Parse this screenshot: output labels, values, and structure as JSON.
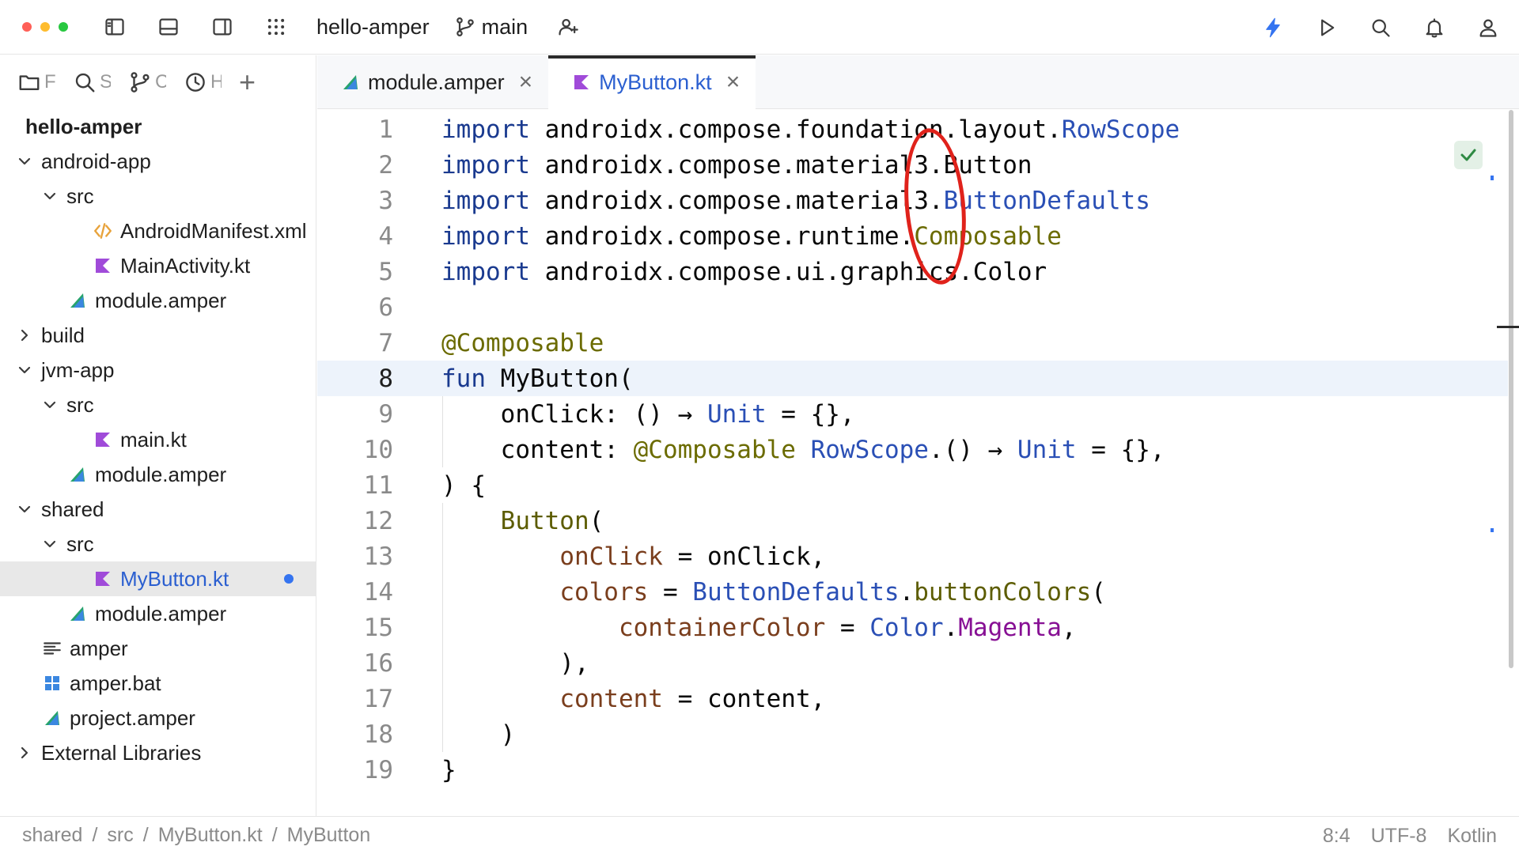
{
  "titlebar": {
    "project_name": "hello-amper",
    "branch": "main",
    "traffic_colors": {
      "close": "#ff5f57",
      "minimize": "#febc2e",
      "zoom": "#28c840"
    }
  },
  "left_tabs": [
    {
      "icon": "folder-icon",
      "label": "F"
    },
    {
      "icon": "search-icon",
      "label": "S"
    },
    {
      "icon": "git-branch-icon",
      "label": "C"
    },
    {
      "icon": "clock-icon",
      "label": "H"
    }
  ],
  "tree": {
    "root": "hello-amper",
    "items": [
      {
        "label": "android-app",
        "depth": 0,
        "chevron": "down",
        "icon": ""
      },
      {
        "label": "src",
        "depth": 1,
        "chevron": "down",
        "icon": ""
      },
      {
        "label": "AndroidManifest.xml",
        "depth": 2,
        "chevron": "",
        "icon": "xml-icon"
      },
      {
        "label": "MainActivity.kt",
        "depth": 2,
        "chevron": "",
        "icon": "kotlin-icon"
      },
      {
        "label": "module.amper",
        "depth": 1,
        "chevron": "",
        "icon": "amper-icon"
      },
      {
        "label": "build",
        "depth": 0,
        "chevron": "right",
        "icon": ""
      },
      {
        "label": "jvm-app",
        "depth": 0,
        "chevron": "down",
        "icon": ""
      },
      {
        "label": "src",
        "depth": 1,
        "chevron": "down",
        "icon": ""
      },
      {
        "label": "main.kt",
        "depth": 2,
        "chevron": "",
        "icon": "kotlin-icon"
      },
      {
        "label": "module.amper",
        "depth": 1,
        "chevron": "",
        "icon": "amper-icon"
      },
      {
        "label": "shared",
        "depth": 0,
        "chevron": "down",
        "icon": ""
      },
      {
        "label": "src",
        "depth": 1,
        "chevron": "down",
        "icon": ""
      },
      {
        "label": "MyButton.kt",
        "depth": 2,
        "chevron": "",
        "icon": "kotlin-icon",
        "selected": true,
        "modified": true
      },
      {
        "label": "module.amper",
        "depth": 1,
        "chevron": "",
        "icon": "amper-icon"
      },
      {
        "label": "amper",
        "depth": 0,
        "chevron": "",
        "icon": "text-file-icon"
      },
      {
        "label": "amper.bat",
        "depth": 0,
        "chevron": "",
        "icon": "windows-icon"
      },
      {
        "label": "project.amper",
        "depth": 0,
        "chevron": "",
        "icon": "amper-icon"
      },
      {
        "label": "External Libraries",
        "depth": 0,
        "chevron": "right",
        "icon": ""
      }
    ]
  },
  "editor_tabs": [
    {
      "label": "module.amper",
      "icon": "amper-icon",
      "active": false
    },
    {
      "label": "MyButton.kt",
      "icon": "kotlin-icon",
      "active": true
    }
  ],
  "editor": {
    "current_line": 8,
    "lines": [
      [
        [
          "import",
          "kw"
        ],
        [
          " androidx.compose.foundation.layout.",
          "pkg"
        ],
        [
          "RowScope",
          "cls"
        ]
      ],
      [
        [
          "import",
          "kw"
        ],
        [
          " androidx.compose.material3.Button",
          "pkg"
        ]
      ],
      [
        [
          "import",
          "kw"
        ],
        [
          " androidx.compose.material3.",
          "pkg"
        ],
        [
          "ButtonDefaults",
          "cls"
        ]
      ],
      [
        [
          "import",
          "kw"
        ],
        [
          " androidx.compose.runtime.",
          "pkg"
        ],
        [
          "Composable",
          "ann"
        ]
      ],
      [
        [
          "import",
          "kw"
        ],
        [
          " androidx.compose.ui.graphics.Color",
          "pkg"
        ]
      ],
      [],
      [
        [
          "@Composable",
          "ann"
        ]
      ],
      [
        [
          "fun",
          "kw"
        ],
        [
          " MyButton(",
          "fn"
        ]
      ],
      [
        [
          "    onClick: () → ",
          "plain"
        ],
        [
          "Unit",
          "cls"
        ],
        [
          " = {},",
          "plain"
        ]
      ],
      [
        [
          "    content: ",
          "plain"
        ],
        [
          "@Composable",
          "ann"
        ],
        [
          " ",
          "plain"
        ],
        [
          "RowScope",
          "cls"
        ],
        [
          ".() → ",
          "plain"
        ],
        [
          "Unit",
          "cls"
        ],
        [
          " = {},",
          "plain"
        ]
      ],
      [
        [
          ") {",
          "plain"
        ]
      ],
      [
        [
          "    ",
          "plain"
        ],
        [
          "Button",
          "call"
        ],
        [
          "(",
          "plain"
        ]
      ],
      [
        [
          "        ",
          "plain"
        ],
        [
          "onClick",
          "param"
        ],
        [
          " = onClick,",
          "plain"
        ]
      ],
      [
        [
          "        ",
          "plain"
        ],
        [
          "colors",
          "param"
        ],
        [
          " = ",
          "plain"
        ],
        [
          "ButtonDefaults",
          "cls"
        ],
        [
          ".",
          "plain"
        ],
        [
          "buttonColors",
          "call"
        ],
        [
          "(",
          "plain"
        ]
      ],
      [
        [
          "            ",
          "plain"
        ],
        [
          "containerColor",
          "param"
        ],
        [
          " = ",
          "plain"
        ],
        [
          "Color",
          "cls"
        ],
        [
          ".",
          "plain"
        ],
        [
          "Magenta",
          "prop"
        ],
        [
          ",",
          "plain"
        ]
      ],
      [
        [
          "        ),",
          "plain"
        ]
      ],
      [
        [
          "        ",
          "plain"
        ],
        [
          "content",
          "param"
        ],
        [
          " = content,",
          "plain"
        ]
      ],
      [
        [
          "    )",
          "plain"
        ]
      ],
      [
        [
          "}",
          "plain"
        ]
      ]
    ]
  },
  "statusbar": {
    "breadcrumbs": [
      "shared",
      "src",
      "MyButton.kt",
      "MyButton"
    ],
    "separator": "/",
    "position": "8:4",
    "encoding": "UTF-8",
    "language": "Kotlin"
  },
  "colors": {
    "accent": "#3574f0",
    "annotation_circle": "#e0221b"
  }
}
